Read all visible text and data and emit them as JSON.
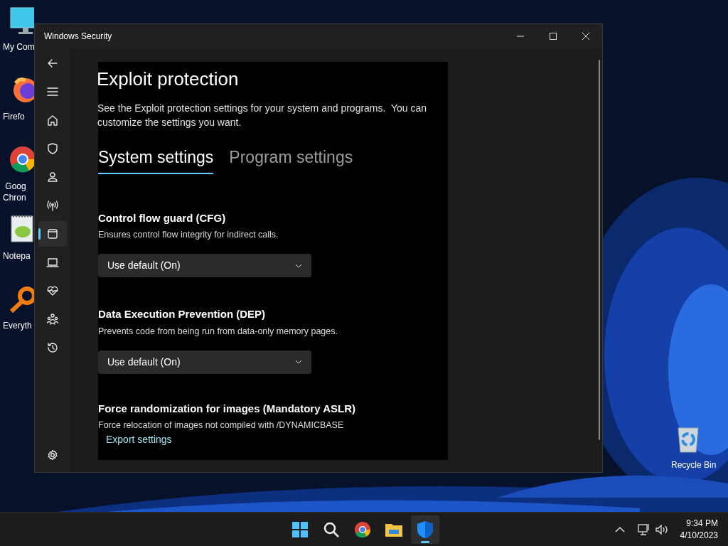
{
  "desktop_icons": [
    {
      "kind": "computer",
      "lines": [
        "My Com"
      ]
    },
    {
      "kind": "firefox",
      "lines": [
        "Firefo"
      ]
    },
    {
      "kind": "chrome",
      "lines": [
        "Goog",
        "Chron"
      ]
    },
    {
      "kind": "notepad",
      "lines": [
        "Notepa"
      ]
    },
    {
      "kind": "everything",
      "lines": [
        "Everyth"
      ]
    },
    {
      "kind": "recycle",
      "lines": [
        "Recycle Bin"
      ]
    }
  ],
  "window": {
    "title": "Windows Security"
  },
  "sidebar": {
    "items": [
      {
        "kind": "back",
        "selected": false
      },
      {
        "kind": "menu",
        "selected": false
      },
      {
        "kind": "home",
        "selected": false
      },
      {
        "kind": "shield",
        "selected": false
      },
      {
        "kind": "person",
        "selected": false
      },
      {
        "kind": "antenna",
        "selected": false
      },
      {
        "kind": "app",
        "selected": true
      },
      {
        "kind": "laptop",
        "selected": false
      },
      {
        "kind": "heart",
        "selected": false
      },
      {
        "kind": "family",
        "selected": false
      },
      {
        "kind": "history",
        "selected": false
      }
    ],
    "settings_item": {
      "kind": "settings",
      "selected": false
    }
  },
  "page": {
    "title": "Exploit protection",
    "description": "See the Exploit protection settings for your system and programs.  You can customize the settings you want.",
    "tabs": [
      {
        "label": "System settings",
        "selected": true
      },
      {
        "label": "Program settings",
        "selected": false
      }
    ],
    "settings": [
      {
        "title": "Control flow guard (CFG)",
        "description": "Ensures control flow integrity for indirect calls.",
        "dropdown": "Use default (On)"
      },
      {
        "title": "Data Execution Prevention (DEP)",
        "description": "Prevents code from being run from data-only memory pages.",
        "dropdown": "Use default (On)"
      },
      {
        "title": "Force randomization for images (Mandatory ASLR)",
        "description": "Force relocation of images not compiled with /DYNAMICBASE"
      }
    ],
    "export_link": "Export settings"
  },
  "taskbar": {
    "apps": [
      {
        "kind": "start",
        "active": false
      },
      {
        "kind": "search",
        "active": false
      },
      {
        "kind": "chrome",
        "active": false
      },
      {
        "kind": "explorer",
        "active": false
      },
      {
        "kind": "security",
        "active": true
      }
    ],
    "time": "9:34 PM",
    "date": "4/10/2023"
  }
}
